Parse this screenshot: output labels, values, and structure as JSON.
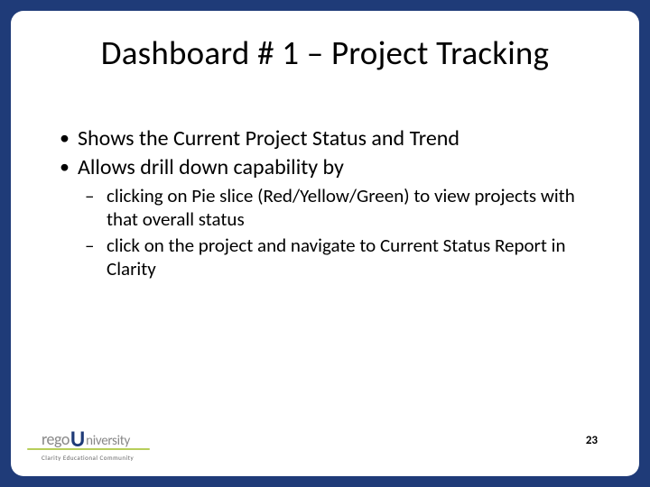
{
  "title": "Dashboard # 1 – Project Tracking",
  "bullets": [
    {
      "text": "Shows the Current Project Status and Trend"
    },
    {
      "text": "Allows drill down capability by",
      "sub": [
        "clicking on Pie slice (Red/Yellow/Green) to view projects with that overall status",
        "click on the project and navigate to Current Status Report in Clarity"
      ]
    }
  ],
  "logo": {
    "part1": "rego",
    "part2": "U",
    "part3": "niversity"
  },
  "tagline": "Clarity Educational Community",
  "page_number": "23"
}
